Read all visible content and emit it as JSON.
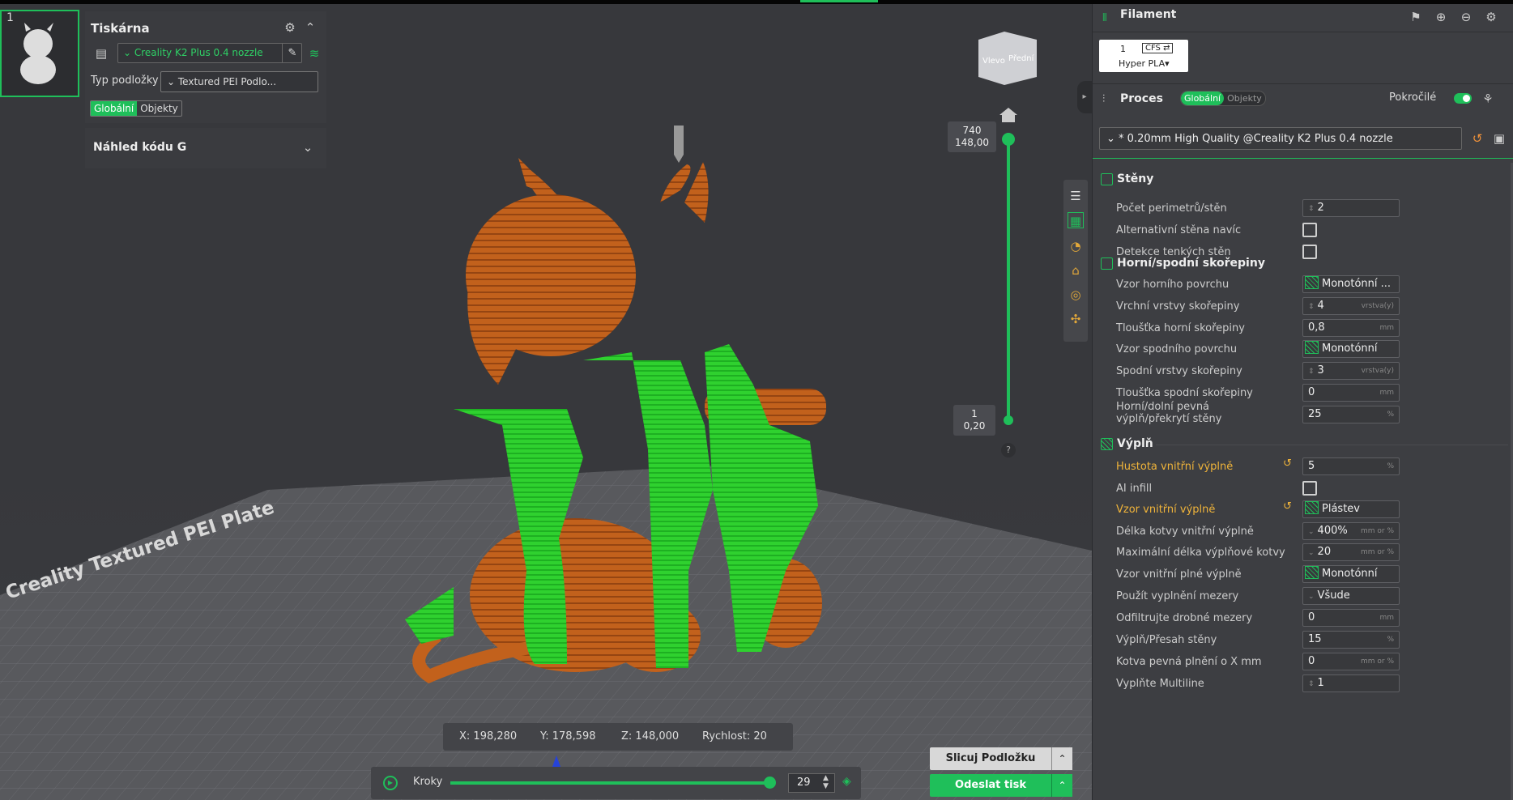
{
  "plate": {
    "number": "1"
  },
  "printer": {
    "title": "Tiskárna",
    "selected": "Creality K2 Plus 0.4 nozzle",
    "bed_label": "Typ podložky",
    "bed_value": "Textured PEI Podlo...",
    "tabs": [
      "Globální",
      "Objekty"
    ]
  },
  "gcode_preview": {
    "title": "Náhled kódu G"
  },
  "view_cube": {
    "left": "Vlevo",
    "front": "Přední"
  },
  "bed_text": "Creality Textured PEI Plate",
  "layer_slider": {
    "top_layer": "740",
    "top_height": "148,00",
    "bottom_layer": "1",
    "bottom_height": "0,20",
    "top_fraction": 1.0,
    "bottom_fraction": 0.0,
    "help": "?"
  },
  "coords": {
    "x": "X: 198,280",
    "y": "Y: 178,598",
    "z": "Z: 148,000",
    "speed": "Rychlost: 20"
  },
  "steps": {
    "label": "Kroky",
    "value": "29",
    "fraction": 1.0
  },
  "actions": {
    "slice": "Slicuj Podložku",
    "send": "Odeslat tisk"
  },
  "filament": {
    "title": "Filament",
    "slot": "1",
    "cfs": "CFS ⇄",
    "material": "Hyper PLA▾"
  },
  "process": {
    "title": "Proces",
    "tabs": [
      "Globální",
      "Objekty"
    ],
    "advanced_label": "Pokročilé",
    "advanced_on": true,
    "profile": "* 0.20mm High Quality @Creality K2 Plus 0.4 nozzle"
  },
  "groups": [
    {
      "title": "Stěny"
    },
    {
      "title": "Horní/spodní skořepiny"
    },
    {
      "title": "Výplň"
    }
  ],
  "settings": [
    {
      "label": "Počet perimetrů/stěn",
      "type": "spin",
      "value": "2",
      "unit": ""
    },
    {
      "label": "Alternativní stěna navíc",
      "type": "check",
      "value": "",
      "unit": ""
    },
    {
      "label": "Detekce tenkých stěn",
      "type": "check",
      "value": "",
      "unit": ""
    },
    {
      "label": "Vzor horního povrchu",
      "type": "pattern",
      "value": "Monotónní ...",
      "unit": ""
    },
    {
      "label": "Vrchní vrstvy skořepiny",
      "type": "spin",
      "value": "4",
      "unit": "vrstva(y)"
    },
    {
      "label": "Tloušťka horní skořepiny",
      "type": "text",
      "value": "0,8",
      "unit": "mm"
    },
    {
      "label": "Vzor spodního povrchu",
      "type": "pattern",
      "value": "Monotónní",
      "unit": ""
    },
    {
      "label": "Spodní vrstvy skořepiny",
      "type": "spin",
      "value": "3",
      "unit": "vrstva(y)"
    },
    {
      "label": "Tloušťka spodní skořepiny",
      "type": "text",
      "value": "0",
      "unit": "mm"
    },
    {
      "label": "Horní/dolní pevná výplň/překrytí stěny",
      "type": "text",
      "value": "25",
      "unit": "%"
    },
    {
      "label": "Hustota vnitřní výplně",
      "type": "text",
      "value": "5",
      "unit": "%",
      "modified": true
    },
    {
      "label": "AI infill",
      "type": "check",
      "value": "",
      "unit": ""
    },
    {
      "label": "Vzor vnitřní výplně",
      "type": "pattern",
      "value": "Plástev",
      "unit": "",
      "modified": true
    },
    {
      "label": "Délka kotvy vnitřní výplně",
      "type": "combo",
      "value": "400%",
      "unit": "mm or %"
    },
    {
      "label": "Maximální délka výplňové kotvy",
      "type": "combo",
      "value": "20",
      "unit": "mm or %"
    },
    {
      "label": "Vzor vnitřní plné výplně",
      "type": "pattern",
      "value": "Monotónní",
      "unit": ""
    },
    {
      "label": "Použít vyplnění mezery",
      "type": "combo",
      "value": "Všude",
      "unit": ""
    },
    {
      "label": "Odfiltrujte drobné mezery",
      "type": "text",
      "value": "0",
      "unit": "mm"
    },
    {
      "label": "Výplň/Přesah stěny",
      "type": "text",
      "value": "15",
      "unit": "%"
    },
    {
      "label": "Kotva pevná plnění o X mm",
      "type": "text",
      "value": "0",
      "unit": "mm or %"
    },
    {
      "label": "Vyplňte Multiline",
      "type": "spin",
      "value": "1",
      "unit": ""
    }
  ],
  "colors": {
    "accent": "#1fbf5a",
    "modified": "#f0b43a",
    "model": "#c8641e",
    "support": "#28c828"
  }
}
